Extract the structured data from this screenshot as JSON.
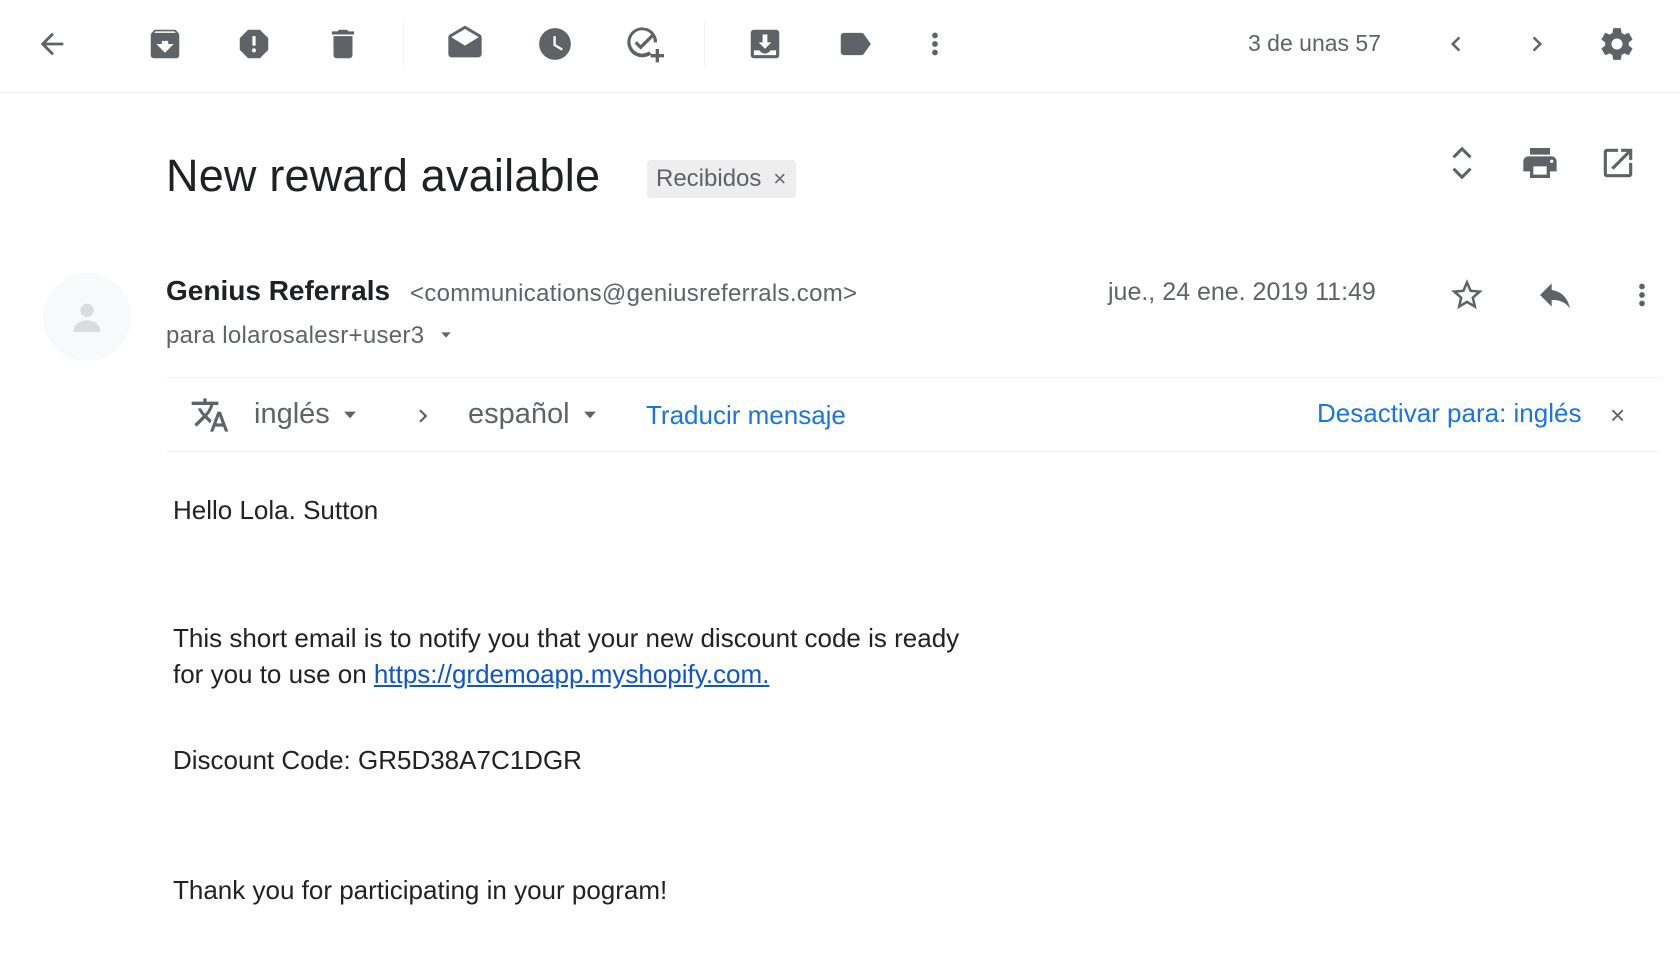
{
  "toolbar": {
    "counter": "3 de unas 57",
    "icons": [
      "back-arrow-icon",
      "archive-icon",
      "report-spam-icon",
      "delete-icon",
      "mark-unread-icon",
      "snooze-icon",
      "add-task-icon",
      "move-to-icon",
      "label-icon",
      "more-vert-icon",
      "chevron-left-icon",
      "chevron-right-icon",
      "gear-icon"
    ]
  },
  "header": {
    "subject": "New reward available",
    "label_chip": "Recibidos",
    "label_chip_close": "×"
  },
  "message": {
    "sender_name": "Genius Referrals",
    "sender_email": "<communications@geniusreferrals.com>",
    "to": "para lolarosalesr+user3",
    "date": "jue., 24 ene. 2019 11:49"
  },
  "translate": {
    "source_lang": "inglés",
    "target_lang": "español",
    "translate_link": "Traducir mensaje",
    "disable_link": "Desactivar para: inglés",
    "disable_close": "×"
  },
  "body": {
    "greeting": "Hello Lola. Sutton",
    "line1": "This short email is to notify you that your new discount code is ready",
    "line2_prefix": "for you to use on ",
    "link": "https://grdemoapp.myshopify.com.",
    "discount": "Discount Code: GR5D38A7C1DGR",
    "thanks": "Thank you for participating in your pogram!"
  },
  "colors": {
    "icon_gray": "#5f6368",
    "link_blue": "#1a73e8",
    "body_link": "#1155cc"
  }
}
